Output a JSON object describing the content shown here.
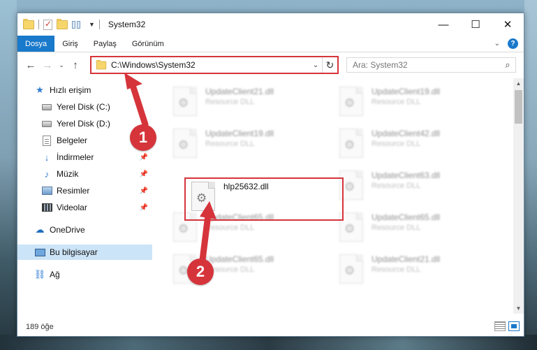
{
  "window": {
    "title": "System32",
    "controls": {
      "minimize": "—",
      "maximize": "☐",
      "close": "✕"
    }
  },
  "ribbon": {
    "tabs": [
      "Dosya",
      "Giriş",
      "Paylaş",
      "Görünüm"
    ],
    "active_tab": "Dosya",
    "help": "?"
  },
  "address": {
    "path": "C:\\Windows\\System32",
    "search_placeholder": "Ara: System32"
  },
  "sidebar": {
    "items": [
      {
        "label": "Hızlı erişim",
        "icon": "star-icon",
        "pinned": false
      },
      {
        "label": "Yerel Disk (C:)",
        "icon": "drive-icon",
        "pinned": true
      },
      {
        "label": "Yerel Disk (D:)",
        "icon": "drive-icon",
        "pinned": true
      },
      {
        "label": "Belgeler",
        "icon": "documents-icon",
        "pinned": true
      },
      {
        "label": "İndirmeler",
        "icon": "download-icon",
        "pinned": true
      },
      {
        "label": "Müzik",
        "icon": "music-icon",
        "pinned": true
      },
      {
        "label": "Resimler",
        "icon": "pictures-icon",
        "pinned": true
      },
      {
        "label": "Videolar",
        "icon": "videos-icon",
        "pinned": true
      },
      {
        "label": "OneDrive",
        "icon": "cloud-icon",
        "pinned": false
      },
      {
        "label": "Bu bilgisayar",
        "icon": "pc-icon",
        "pinned": false,
        "selected": true
      },
      {
        "label": "Ağ",
        "icon": "network-icon",
        "pinned": false
      }
    ]
  },
  "files": {
    "type_label": "Resource DLL",
    "items": [
      {
        "name": "UpdateClient21.dll",
        "type": "Resource DLL",
        "blurred": true
      },
      {
        "name": "UpdateClient19.dll",
        "type": "Resource DLL",
        "blurred": true
      },
      {
        "name": "UpdateClient19.dll",
        "type": "Resource DLL",
        "blurred": true
      },
      {
        "name": "UpdateClient42.dll",
        "type": "Resource DLL",
        "blurred": true
      },
      {
        "name": "hlp25632.dll",
        "type": "",
        "blurred": false
      },
      {
        "name": "UpdateClient63.dll",
        "type": "Resource DLL",
        "blurred": true
      },
      {
        "name": "UpdateClient65.dll",
        "type": "Resource DLL",
        "blurred": true
      },
      {
        "name": "UpdateClient65.dll",
        "type": "Resource DLL",
        "blurred": true
      },
      {
        "name": "UpdateClient65.dll",
        "type": "Resource DLL",
        "blurred": true
      },
      {
        "name": "UpdateClient21.dll",
        "type": "Resource DLL",
        "blurred": true
      }
    ]
  },
  "status": {
    "count": "189 öğe"
  },
  "annotations": {
    "callout1": "1",
    "callout2": "2"
  },
  "colors": {
    "accent": "#1979ca",
    "highlight": "#d6343b",
    "selected": "#cce4f7"
  }
}
